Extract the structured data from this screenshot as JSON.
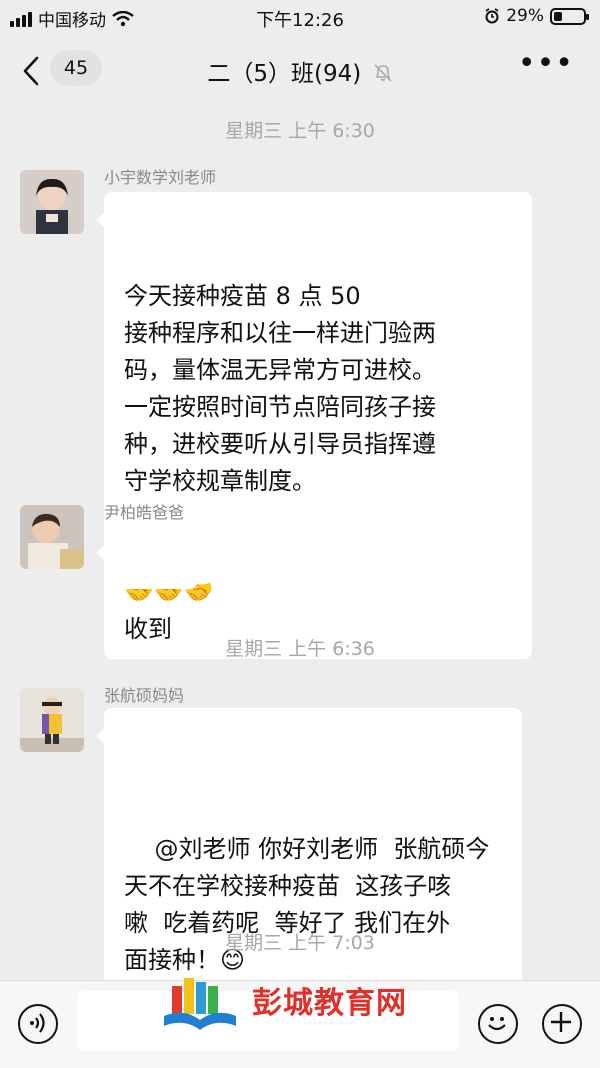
{
  "status_bar": {
    "carrier": "中国移动",
    "time": "下午12:26",
    "battery": "29%",
    "battery_level": 0.29
  },
  "nav": {
    "unread_count": "45",
    "title": "二（5）班(94)",
    "more_label": "•••"
  },
  "messages": [
    {
      "type": "timestamp",
      "text": "星期三 上午 6:30"
    },
    {
      "type": "message",
      "sender": "小宇数学刘老师",
      "text": "今天接种疫苗 8 点 50\n接种程序和以往一样进门验两\n码，量体温无异常方可进校。\n一定按照时间节点陪同孩子接\n种，进校要听从引导员指挥遵\n守学校规章制度。",
      "emoji": "🤝🤝🤝"
    },
    {
      "type": "message",
      "sender": "尹柏皓爸爸",
      "text": "收到"
    },
    {
      "type": "timestamp",
      "text": "星期三 上午 6:36"
    },
    {
      "type": "message",
      "sender": "张航硕妈妈",
      "text": "@刘老师 你好刘老师  张航硕今\n天不在学校接种疫苗  这孩子咳\n嗽  吃着药呢  等好了 我们在外\n面接种！",
      "emoji": "😊"
    },
    {
      "type": "timestamp",
      "text": "星期三 上午 7:03"
    }
  ],
  "watermark": {
    "text": "彭城教育网"
  },
  "icons": [
    "back-icon",
    "mute-icon",
    "more-icon",
    "voice-icon",
    "emoji-icon",
    "add-icon"
  ],
  "colors": {
    "background": "#ededed",
    "bubble": "#ffffff",
    "watermark": "#e0302a"
  }
}
